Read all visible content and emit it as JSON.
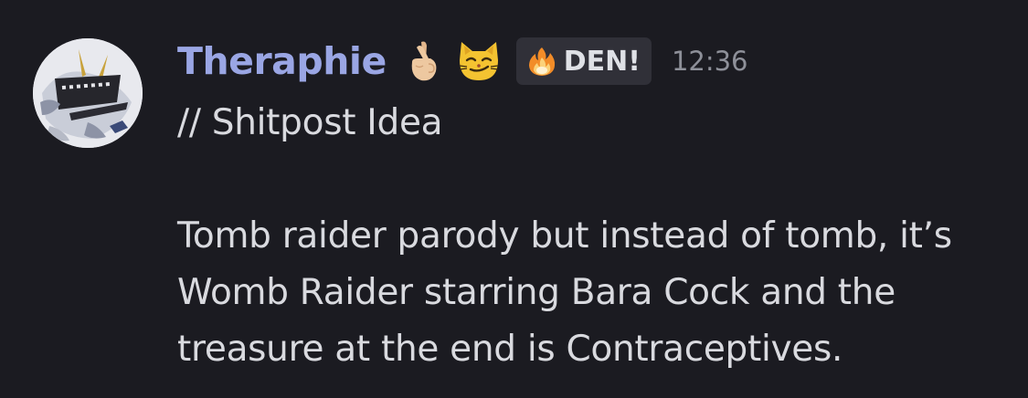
{
  "message": {
    "author": "Theraphie",
    "author_color": "#9aa6e4",
    "badges": [
      {
        "icon": "crossed-fingers-emoji"
      },
      {
        "icon": "smirking-cat-emoji"
      }
    ],
    "tag": {
      "icon": "fire-icon",
      "label": "DEN!"
    },
    "timestamp": "12:36",
    "lines": [
      "// Shitpost Idea",
      "",
      "Tomb raider parody but instead of tomb, it’s",
      "Womb Raider starring Bara Cock and the",
      "treasure at the end is Contraceptives."
    ]
  },
  "colors": {
    "background": "#1b1b21",
    "tag_background": "#303038",
    "text": "#d9dadf",
    "timestamp": "#8e9099"
  }
}
